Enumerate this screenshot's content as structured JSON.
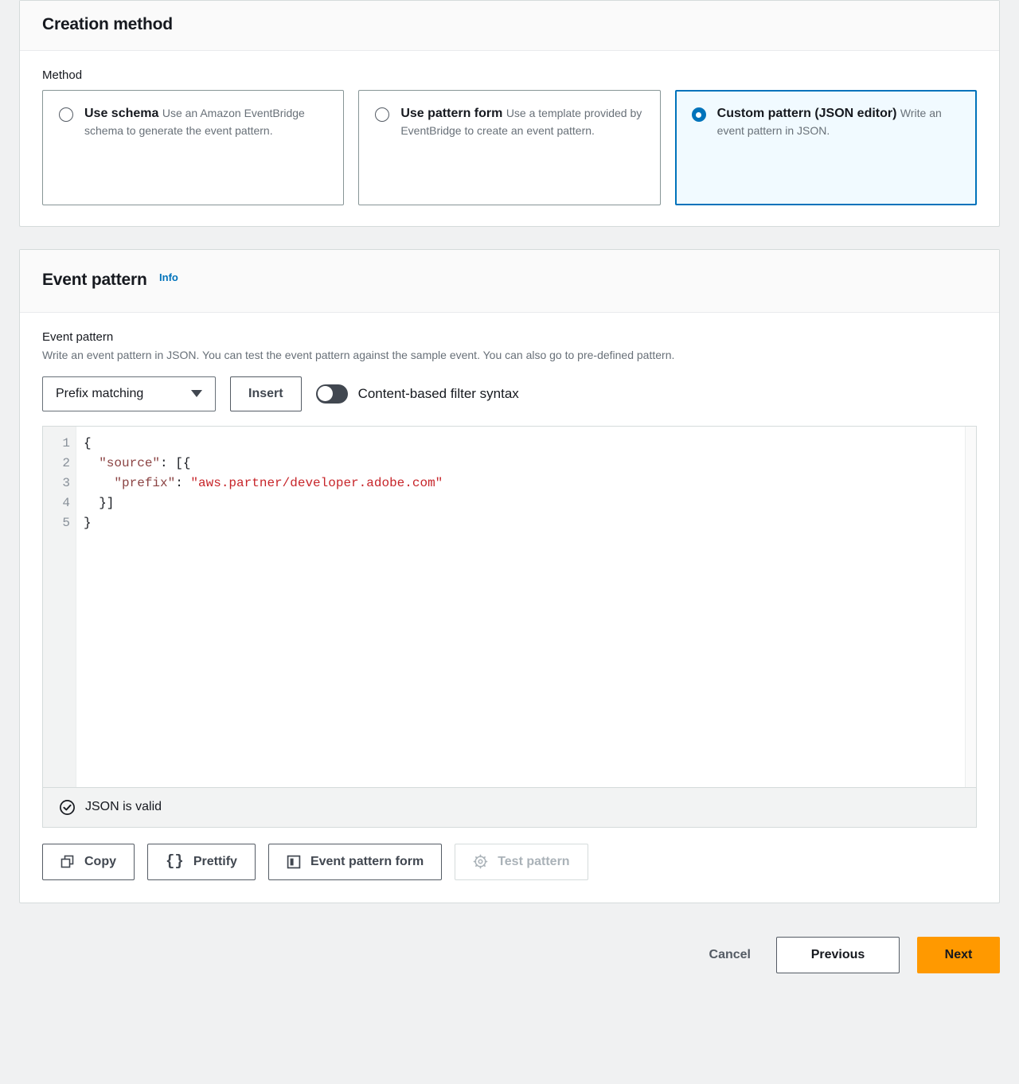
{
  "creation_method": {
    "title": "Creation method",
    "method_label": "Method",
    "options": [
      {
        "title": "Use schema",
        "description": "Use an Amazon EventBridge schema to generate the event pattern.",
        "selected": false
      },
      {
        "title": "Use pattern form",
        "description": "Use a template provided by EventBridge to create an event pattern.",
        "selected": false
      },
      {
        "title": "Custom pattern (JSON editor)",
        "description": "Write an event pattern in JSON.",
        "selected": true
      }
    ]
  },
  "event_pattern": {
    "section_title": "Event pattern",
    "info_label": "Info",
    "field_label": "Event pattern",
    "field_description": "Write an event pattern in JSON. You can test the event pattern against the sample event. You can also go to pre-defined pattern.",
    "pattern_select": {
      "value": "Prefix matching",
      "icon": "chevron-down-icon"
    },
    "insert_label": "Insert",
    "toggle": {
      "label": "Content-based filter syntax",
      "checked": false
    },
    "editor": {
      "line_numbers": [
        "1",
        "2",
        "3",
        "4",
        "5"
      ],
      "lines": [
        [
          {
            "t": "punct",
            "v": "{"
          }
        ],
        [
          {
            "t": "punct",
            "v": "  "
          },
          {
            "t": "key",
            "v": "\"source\""
          },
          {
            "t": "punct",
            "v": ": [{"
          }
        ],
        [
          {
            "t": "punct",
            "v": "    "
          },
          {
            "t": "key",
            "v": "\"prefix\""
          },
          {
            "t": "punct",
            "v": ": "
          },
          {
            "t": "str",
            "v": "\"aws.partner/developer.adobe.com\""
          }
        ],
        [
          {
            "t": "punct",
            "v": "  }]"
          }
        ],
        [
          {
            "t": "punct",
            "v": "}"
          }
        ]
      ]
    },
    "status": {
      "text": "JSON is valid",
      "icon": "check-circle-icon"
    },
    "actions": [
      {
        "label": "Copy",
        "icon": "copy-icon",
        "disabled": false
      },
      {
        "label": "Prettify",
        "icon": "braces-icon",
        "disabled": false
      },
      {
        "label": "Event pattern form",
        "icon": "form-layout-icon",
        "disabled": false
      },
      {
        "label": "Test pattern",
        "icon": "gear-icon",
        "disabled": true
      }
    ]
  },
  "footer": {
    "cancel_label": "Cancel",
    "previous_label": "Previous",
    "next_label": "Next"
  },
  "colors": {
    "accent_blue": "#0073bb",
    "selected_tile_bg": "#f1faff",
    "next_button_orange": "#ff9900",
    "page_bg": "#f0f1f2",
    "json_key": "#8b4343",
    "json_string": "#c7252a"
  }
}
